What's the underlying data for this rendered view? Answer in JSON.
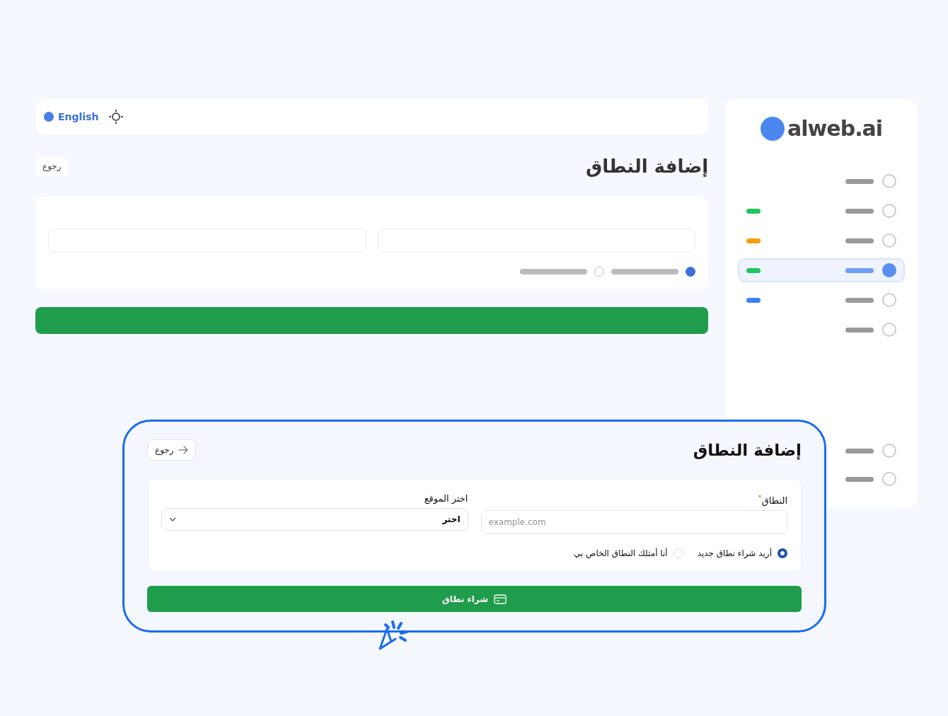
{
  "background_app": {
    "language": "English",
    "title": "إضافة النطاق",
    "back_button": "رجوع",
    "logo": "alweb.ai",
    "sidebar_items": [
      {
        "selected": false
      },
      {
        "selected": false,
        "color": "#22c55e"
      },
      {
        "selected": false,
        "color": "#f59e0b"
      },
      {
        "selected": true,
        "color": "#22c55e"
      },
      {
        "selected": false,
        "color": "#3b82f6"
      },
      {
        "selected": false
      }
    ],
    "sidebar_footer_items": [
      {
        "selected": false
      },
      {
        "selected": false
      }
    ],
    "options": [
      {
        "selected": true
      },
      {
        "selected": false
      }
    ]
  },
  "callout": {
    "title": "إضافة النطاق",
    "back_button": "رجوع",
    "domain_field": {
      "label": "النطاق",
      "required_mark": "*",
      "placeholder": "example.com"
    },
    "site_field": {
      "label": "اختر الموقع",
      "value": "اختر"
    },
    "options": [
      {
        "label": "أريد شراء نطاق جديد",
        "selected": true
      },
      {
        "label": "أنا أمتلك النطاق الخاص بي",
        "selected": false
      }
    ],
    "submit_button": "شراء نطاق"
  }
}
